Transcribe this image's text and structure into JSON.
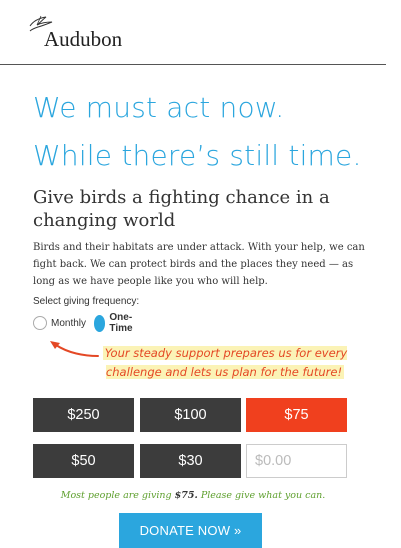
{
  "brand": {
    "name": "Audubon"
  },
  "headline": "We must act now. While there’s still time.",
  "subhead": "Give birds a fighting chance in a changing world",
  "body": "Birds and their habitats are under attack. With your help, we can fight back. We can protect birds and the places they need — as long as we have people like you who will help.",
  "frequency": {
    "label": "Select giving frequency:",
    "options": [
      {
        "label": "Monthly",
        "selected": false
      },
      {
        "label": "One-Time",
        "selected": true
      }
    ]
  },
  "note": "Your steady support prepares us for every challenge and lets us plan for the future!",
  "amounts": [
    "$250",
    "$100",
    "$75",
    "$50",
    "$30"
  ],
  "selected_amount": "$75",
  "custom_amount_placeholder": "$0.00",
  "giving_line": {
    "prefix": "Most people are giving ",
    "amount": "$75.",
    "suffix": " Please give what you can."
  },
  "donate_label": "DONATE NOW »",
  "colors": {
    "accent": "#2ba6de",
    "selected_amount": "#f0401e",
    "amount_button": "#3c3c3c",
    "note_text": "#e44825",
    "giving_line": "#5fa02f"
  },
  "icons": {
    "logo_bird": "bird-outline-icon",
    "arrow": "curved-arrow-icon"
  }
}
